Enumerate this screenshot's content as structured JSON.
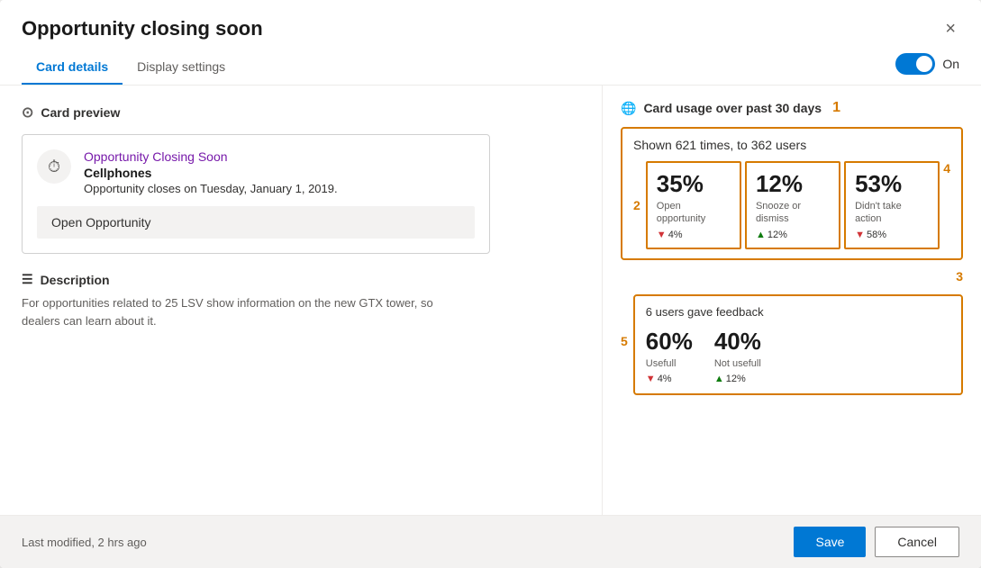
{
  "modal": {
    "title": "Opportunity closing soon",
    "close_label": "×"
  },
  "tabs": {
    "items": [
      {
        "id": "card-details",
        "label": "Card details",
        "active": true
      },
      {
        "id": "display-settings",
        "label": "Display settings",
        "active": false
      }
    ],
    "toggle": {
      "label": "On",
      "checked": true
    }
  },
  "left_panel": {
    "card_preview": {
      "section_label": "Card preview",
      "card": {
        "icon": "⏱",
        "title": "Opportunity Closing Soon",
        "subtitle": "Cellphones",
        "description": "Opportunity closes on Tuesday, January 1, 2019.",
        "action_button": "Open Opportunity"
      }
    },
    "description": {
      "section_label": "Description",
      "text": "For opportunities related to 25 LSV show information on the new GTX tower, so dealers can learn about it."
    }
  },
  "right_panel": {
    "section_label": "Card usage over past 30 days",
    "section_num": "1",
    "shown_text": "Shown 621 times, to 362 users",
    "stats": {
      "num_label": "2",
      "items": [
        {
          "percent": "35%",
          "label": "Open opportunity",
          "change_direction": "down",
          "change_value": "4%",
          "num_label": ""
        },
        {
          "percent": "12%",
          "label": "Snooze or dismiss",
          "change_direction": "up",
          "change_value": "12%",
          "num_label": ""
        },
        {
          "percent": "53%",
          "label": "Didn't take action",
          "change_direction": "down",
          "change_value": "58%",
          "num_label": "4"
        }
      ]
    },
    "line_num": "3",
    "feedback": {
      "num_label": "5",
      "title": "6 users gave feedback",
      "items": [
        {
          "percent": "60%",
          "label": "Usefull",
          "change_direction": "down",
          "change_value": "4%"
        },
        {
          "percent": "40%",
          "label": "Not usefull",
          "change_direction": "up",
          "change_value": "12%"
        }
      ]
    }
  },
  "footer": {
    "status": "Last modified, 2 hrs ago",
    "save_label": "Save",
    "cancel_label": "Cancel"
  }
}
